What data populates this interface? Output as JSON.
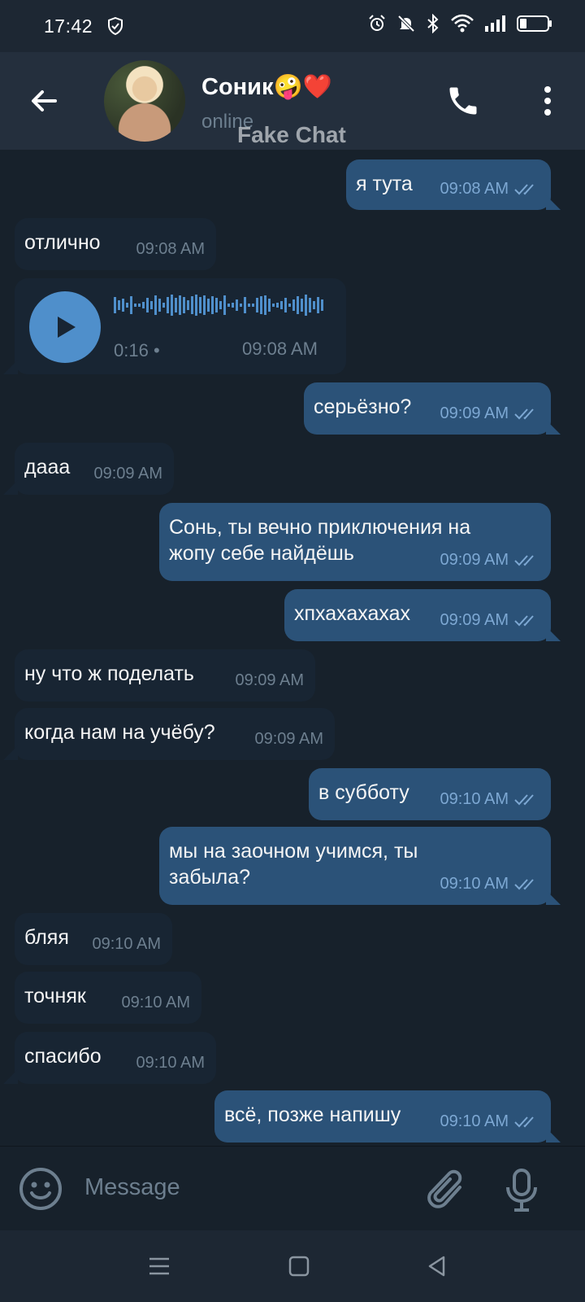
{
  "status_bar": {
    "time": "17:42"
  },
  "header": {
    "contact_name": "Соник🤪❤️",
    "status": "online",
    "watermark": "Fake Chat"
  },
  "messages": [
    {
      "dir": "out",
      "text": "я тута",
      "time": "09:08 AM",
      "read": true
    },
    {
      "dir": "in",
      "text": "отлично",
      "time": "09:08 AM"
    },
    {
      "dir": "in",
      "type": "voice",
      "duration": "0:16",
      "time": "09:08 AM"
    },
    {
      "dir": "out",
      "text": "серьёзно?",
      "time": "09:09 AM",
      "read": true
    },
    {
      "dir": "in",
      "text": "дааа",
      "time": "09:09 AM"
    },
    {
      "dir": "out",
      "text": "Сонь, ты вечно приключения на жопу себе найдёшь",
      "time": "09:09 AM",
      "read": true
    },
    {
      "dir": "out",
      "text": "хпхахахахах",
      "time": "09:09 AM",
      "read": true
    },
    {
      "dir": "in",
      "text": "ну что ж поделать",
      "time": "09:09 AM"
    },
    {
      "dir": "in",
      "text": "когда нам на учёбу?",
      "time": "09:09 AM"
    },
    {
      "dir": "out",
      "text": "в субботу",
      "time": "09:10 AM",
      "read": true
    },
    {
      "dir": "out",
      "text": "мы на заочном учимся, ты забыла?",
      "time": "09:10 AM",
      "read": true
    },
    {
      "dir": "in",
      "text": "бляя",
      "time": "09:10 AM"
    },
    {
      "dir": "in",
      "text": "точняк",
      "time": "09:10 AM"
    },
    {
      "dir": "in",
      "text": "спасибо",
      "time": "09:10 AM"
    },
    {
      "dir": "out",
      "text": "всё, позже напишу",
      "time": "09:10 AM",
      "read": true
    }
  ],
  "composer": {
    "placeholder": "Message"
  },
  "colors": {
    "background": "#17212b",
    "incoming": "#182533",
    "outgoing": "#2b5278",
    "accent": "#4f8fcb"
  },
  "icons": [
    "back-arrow-icon",
    "phone-icon",
    "more-vert-icon",
    "play-icon",
    "double-check-icon",
    "emoji-icon",
    "attach-icon",
    "mic-icon",
    "menu-icon",
    "home-icon",
    "back-icon"
  ]
}
